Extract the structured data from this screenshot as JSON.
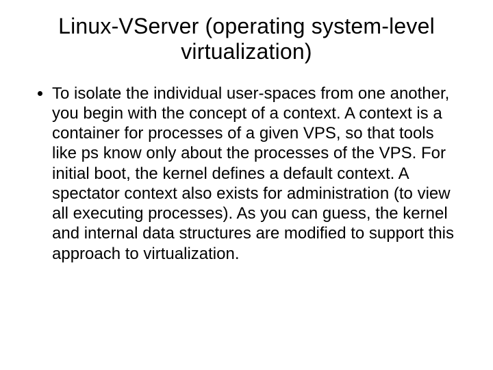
{
  "slide": {
    "title": "Linux-VServer (operating system-level virtualization)",
    "bullets": [
      "To isolate the individual user-spaces from one another, you begin with the concept of a context. A context is a container for processes of a given VPS, so that tools like ps know only about the processes of the VPS. For initial boot, the kernel defines a default context. A spectator context also exists for administration (to view all executing processes). As you can guess, the kernel and internal data structures are modified to support this approach to virtualization."
    ]
  }
}
